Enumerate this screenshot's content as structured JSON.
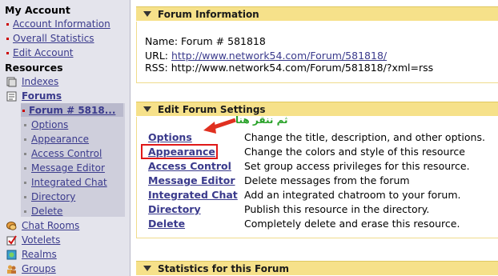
{
  "sidebar": {
    "my_account": "My Account",
    "account_links": [
      "Account Information",
      "Overall Statistics",
      "Edit Account"
    ],
    "resources": "Resources",
    "indexes": "Indexes",
    "forums": "Forums",
    "forum_item": "Forum # 5818...",
    "forum_subitems": [
      "Options",
      "Appearance",
      "Access Control",
      "Message Editor",
      "Integrated Chat",
      "Directory",
      "Delete"
    ],
    "chat_rooms": "Chat Rooms",
    "votelets": "Votelets",
    "realms": "Realms",
    "groups": "Groups"
  },
  "forum_info": {
    "title": "Forum Information",
    "name_line": "Name: Forum # 581818",
    "url_label": "URL:",
    "url": "http://www.network54.com/Forum/581818/",
    "rss_line": "RSS: http://www.network54.com/Forum/581818/?xml=rss"
  },
  "edit_settings": {
    "title": "Edit Forum Settings",
    "annotation": "ثم ننقر هنا",
    "items": [
      {
        "label": "Options",
        "desc": "Change the title, description, and other options."
      },
      {
        "label": "Appearance",
        "desc": "Change the colors and style of this resource"
      },
      {
        "label": "Access Control",
        "desc": "Set group access privileges for this resource."
      },
      {
        "label": "Message Editor",
        "desc": "Delete messages from the forum"
      },
      {
        "label": "Integrated Chat",
        "desc": "Add an integrated chatroom to your forum."
      },
      {
        "label": "Directory",
        "desc": "Publish this resource in the directory."
      },
      {
        "label": "Delete",
        "desc": "Completely delete and erase this resource."
      }
    ]
  },
  "statistics": {
    "title": "Statistics for this Forum"
  },
  "colors": {
    "sidebar_bg": "#e4e4ec",
    "panel_header": "#f6e18a",
    "link": "#3a3a8c",
    "highlight": "#e01818",
    "annotation": "#27a127"
  },
  "icons": [
    "indexes-icon",
    "forums-icon",
    "chat-rooms-icon",
    "votelets-icon",
    "realms-icon",
    "groups-icon",
    "triangle-down-icon",
    "red-arrow-icon"
  ]
}
